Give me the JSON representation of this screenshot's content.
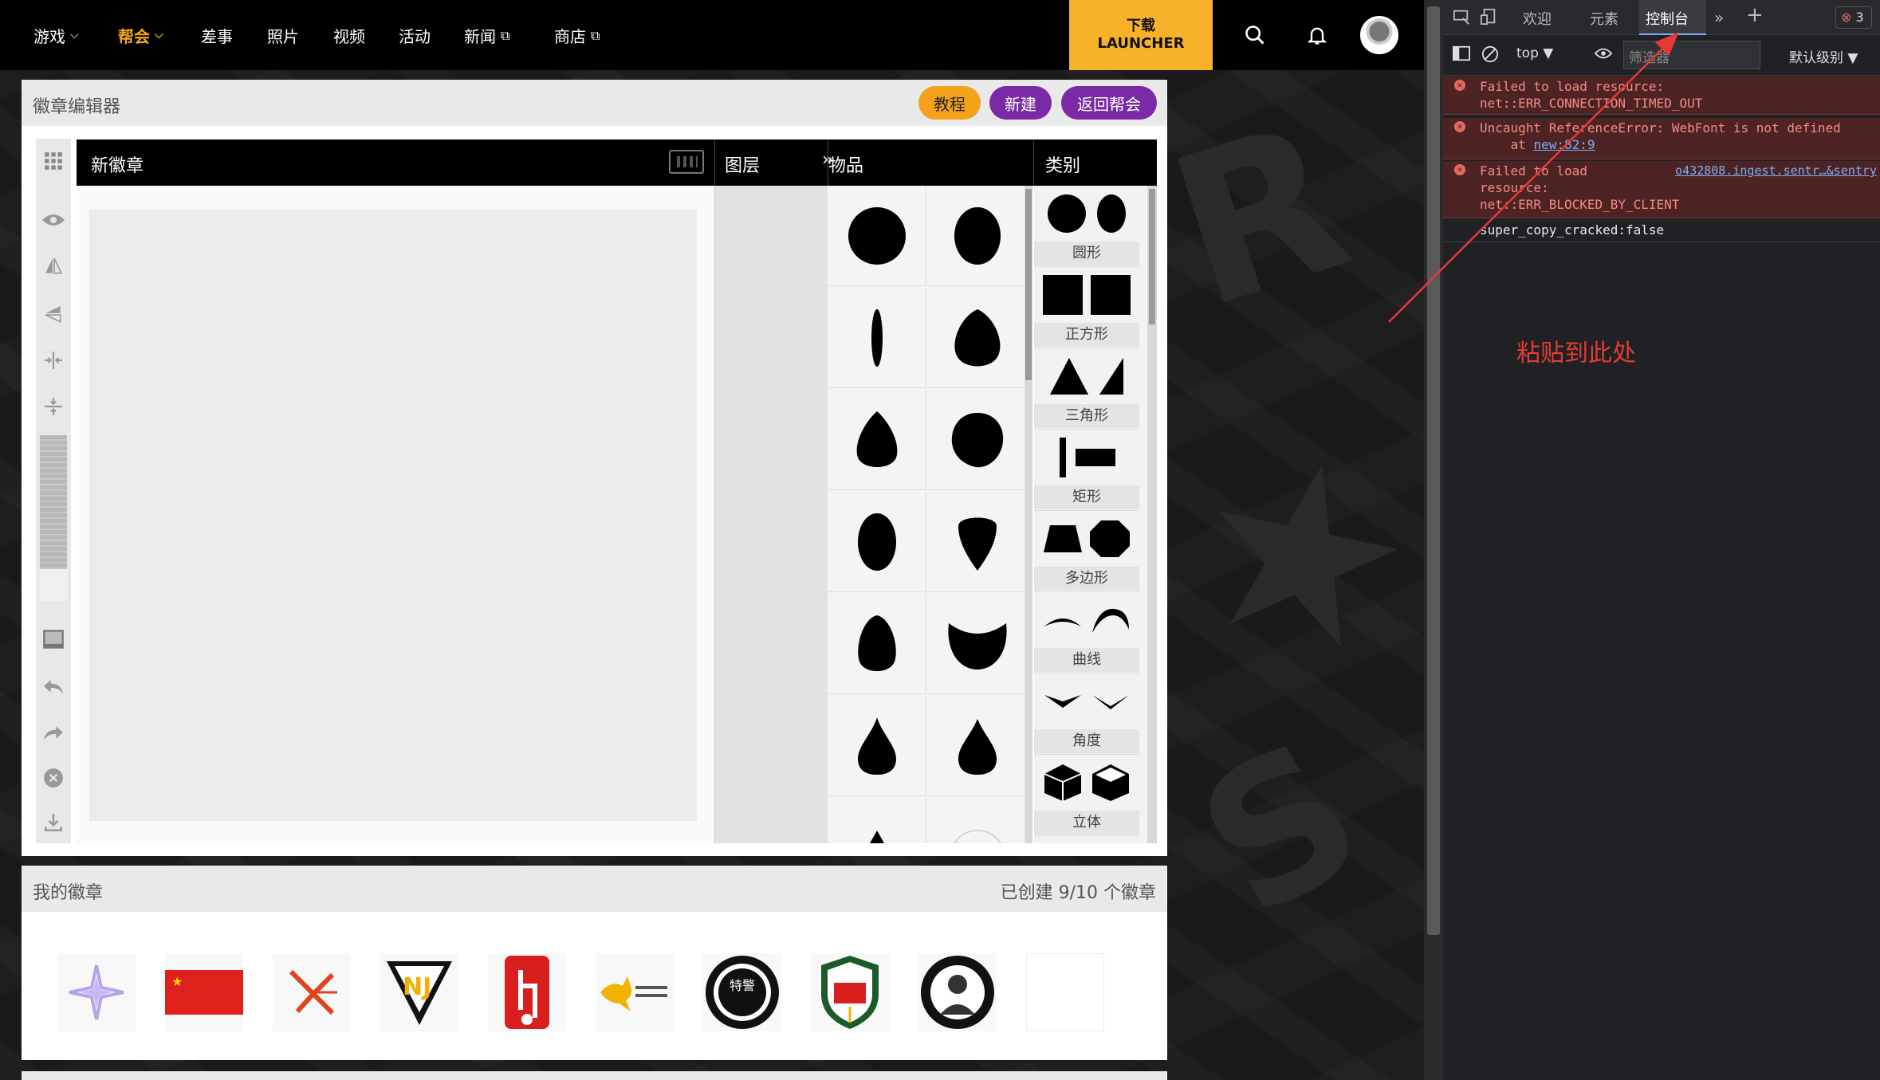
{
  "nav": {
    "items": [
      {
        "label": "游戏",
        "has_dropdown": true
      },
      {
        "label": "帮会",
        "has_dropdown": true,
        "active": true
      },
      {
        "label": "差事"
      },
      {
        "label": "照片"
      },
      {
        "label": "视频"
      },
      {
        "label": "活动"
      },
      {
        "label": "新闻",
        "external": true
      },
      {
        "label": "商店",
        "external": true
      }
    ],
    "launcher_line1": "下载",
    "launcher_line2": "LAUNCHER",
    "accent_color": "#f8b22a"
  },
  "editor": {
    "title": "徽章编辑器",
    "buttons": {
      "tutorial": "教程",
      "new": "新建",
      "back": "返回帮会"
    },
    "badge_name": "新徽章",
    "layers_label": "图层",
    "items_label": "物品",
    "categories_label": "类别",
    "categories": [
      {
        "label": "圆形"
      },
      {
        "label": "正方形"
      },
      {
        "label": "三角形"
      },
      {
        "label": "矩形"
      },
      {
        "label": "多边形"
      },
      {
        "label": "曲线"
      },
      {
        "label": "角度"
      },
      {
        "label": "立体"
      }
    ],
    "tools": [
      "grid-icon",
      "eye-icon",
      "flip-horizontal-icon",
      "flip-vertical-icon",
      "center-horizontal-icon",
      "center-vertical-icon",
      "image-icon",
      "undo-icon",
      "redo-icon",
      "delete-icon",
      "download-icon"
    ]
  },
  "my_badges": {
    "title": "我的徽章",
    "count_text": "已创建 9/10 个徽章",
    "badges": [
      {
        "name": "star-badge"
      },
      {
        "name": "china-flag-badge"
      },
      {
        "name": "x-logo-badge"
      },
      {
        "name": "nj-triangle-badge"
      },
      {
        "name": "red-seal-badge"
      },
      {
        "name": "kangaroo-badge"
      },
      {
        "name": "swat-badge",
        "text": "特警"
      },
      {
        "name": "army-shield-badge"
      },
      {
        "name": "anonymous-badge"
      },
      {
        "name": "empty-slot"
      }
    ]
  },
  "devtools": {
    "tabs": [
      "欢迎",
      "元素",
      "控制台"
    ],
    "active_tab": "控制台",
    "error_count": "3",
    "context": "top",
    "filter_placeholder": "筛选器",
    "level": "默认级别",
    "messages": [
      {
        "type": "error",
        "lines": [
          "Failed to load resource:",
          "net::ERR_CONNECTION_TIMED_OUT"
        ]
      },
      {
        "type": "error",
        "lines": [
          "Uncaught ReferenceError: WebFont is not defined",
          "    at "
        ],
        "link": "new:82:9"
      },
      {
        "type": "error",
        "lines": [
          "Failed to load",
          "resource:",
          "net::ERR_BLOCKED_BY_CLIENT"
        ],
        "source": "o432808.ingest.sentr…&sentry"
      },
      {
        "type": "log",
        "text": "super_copy_cracked:false"
      }
    ]
  },
  "annotation": "粘贴到此处"
}
